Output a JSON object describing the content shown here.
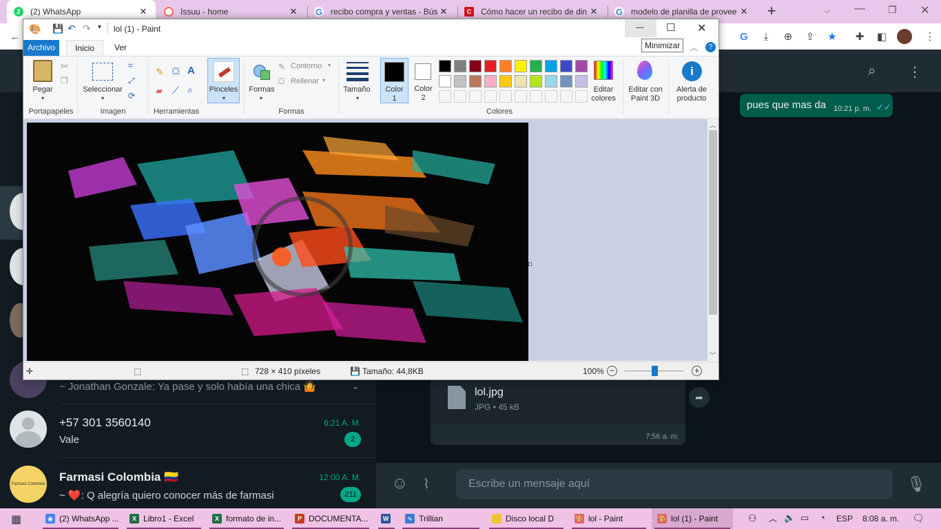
{
  "browser": {
    "tabs": [
      {
        "title": "(2) WhatsApp",
        "icon": "whatsapp-icon",
        "color": "#25d366",
        "badge": "2",
        "active": true
      },
      {
        "title": "Issuu - home",
        "icon": "issuu-icon",
        "color": "#f36d5d"
      },
      {
        "title": "recibo compra y ventas - Bús",
        "icon": "google-icon",
        "color": "#4285f4"
      },
      {
        "title": "Cómo hacer un recibo de din",
        "icon": "c-icon",
        "color": "#d4141e"
      },
      {
        "title": "modelo de planilla de provee",
        "icon": "google-icon",
        "color": "#4285f4"
      }
    ],
    "new_tab": "+",
    "tooltip": "Minimizar"
  },
  "paint": {
    "title": "lol (1) - Paint",
    "ribbon_tabs": [
      "Archivo",
      "Inicio",
      "Ver"
    ],
    "groups": {
      "portapapeles": "Portapapeles",
      "imagen": "Imagen",
      "herramientas": "Herramientas",
      "formas": "Formas",
      "colores": "Colores"
    },
    "buttons": {
      "pegar": "Pegar",
      "seleccionar": "Seleccionar",
      "pinceles": "Pinceles",
      "formas": "Formas",
      "contorno": "Contorno",
      "rellenar": "Rellenar",
      "tamano": "Tamaño",
      "color1_a": "Color",
      "color1_b": "1",
      "color2_a": "Color",
      "color2_b": "2",
      "editar_colores_a": "Editar",
      "editar_colores_b": "colores",
      "paint3d_a": "Editar con",
      "paint3d_b": "Paint 3D",
      "alerta_a": "Alerta de",
      "alerta_b": "producto"
    },
    "palette_row1": [
      "#000000",
      "#7f7f7f",
      "#880015",
      "#ed1c24",
      "#ff7f27",
      "#fff200",
      "#22b14c",
      "#00a2e8",
      "#3f48cc",
      "#a349a4"
    ],
    "palette_row2": [
      "#ffffff",
      "#c3c3c3",
      "#b97a57",
      "#ffaec9",
      "#ffc90e",
      "#efe4b0",
      "#b5e61d",
      "#99d9ea",
      "#7092be",
      "#c8bfe7"
    ],
    "status": {
      "dimensions": "728 × 410 píxeles",
      "size": "Tamaño: 44,8KB",
      "zoom": "100%"
    }
  },
  "whatsapp": {
    "sent_message": "pues que mas da",
    "sent_time": "10:21 p. m.",
    "file": {
      "name": "lol.jpg",
      "meta": "JPG • 45 kB",
      "time": "7:56 a. m."
    },
    "compose_placeholder": "Escribe un mensaje aquí",
    "chats": [
      {
        "name": "",
        "msg": "~ Jonathan Gonzale: Ya pase y solo había una chica 🤷",
        "time": ""
      },
      {
        "name": "+57 301 3560140",
        "msg": "Vale",
        "time": "6:21 A. M.",
        "badge": "2"
      },
      {
        "name": "Farmasi Colombia 🇨🇴",
        "msg": "~ ❤️: Q alegría quiero conocer más de farmasi",
        "time": "12:00 A. M.",
        "badge": "211",
        "avatar_text": "Farmasi Colombia"
      }
    ]
  },
  "taskbar": {
    "items": [
      {
        "label": "(2) WhatsApp ...",
        "icon": "chrome-icon",
        "color": "#4285f4"
      },
      {
        "label": "Libro1 - Excel",
        "icon": "excel-icon",
        "color": "#1d6f42"
      },
      {
        "label": "formato de in...",
        "icon": "excel-icon",
        "color": "#1d6f42"
      },
      {
        "label": "DOCUMENTA...",
        "icon": "powerpoint-icon",
        "color": "#c43e1c"
      },
      {
        "label": "",
        "icon": "word-icon",
        "color": "#2b579a"
      },
      {
        "label": "Trillian",
        "icon": "trillian-icon",
        "color": "#3a7bd5"
      },
      {
        "label": "Disco local D",
        "icon": "folder-icon",
        "color": "#f1c232"
      },
      {
        "label": "lol - Paint",
        "icon": "paint-icon",
        "color": "#e06666"
      },
      {
        "label": "lol (1) - Paint",
        "icon": "paint-icon",
        "color": "#e06666",
        "active": true
      }
    ],
    "language": "ESP",
    "time": "8:08 a. m."
  }
}
